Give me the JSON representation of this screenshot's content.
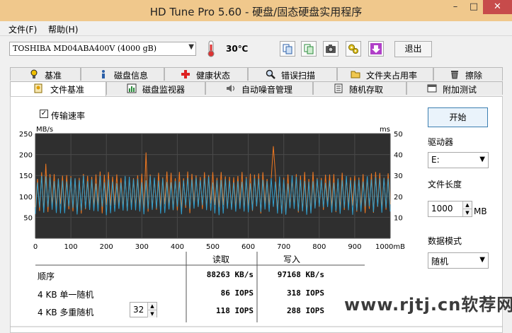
{
  "window": {
    "title": "HD Tune Pro 5.60 - 硬盘/固态硬盘实用程序",
    "min": "–",
    "max": "□",
    "close": "✕"
  },
  "menu": {
    "file": "文件(F)",
    "help": "帮助(H)"
  },
  "toolbar": {
    "drive": "TOSHIBA MD04ABA400V (4000 gB)",
    "temperature": "30℃",
    "exit": "退出"
  },
  "tabs_row1": [
    {
      "label": "基准",
      "icon": "benchmark-icon"
    },
    {
      "label": "磁盘信息",
      "icon": "disk-info-icon"
    },
    {
      "label": "健康状态",
      "icon": "health-icon"
    },
    {
      "label": "错误扫描",
      "icon": "error-scan-icon"
    },
    {
      "label": "文件夹占用率",
      "icon": "folder-icon"
    },
    {
      "label": "擦除",
      "icon": "erase-icon"
    }
  ],
  "tabs_row2": [
    {
      "label": "文件基准",
      "icon": "file-benchmark-icon",
      "active": true
    },
    {
      "label": "磁盘监视器",
      "icon": "disk-monitor-icon"
    },
    {
      "label": "自动噪音管理",
      "icon": "speaker-icon"
    },
    {
      "label": "随机存取",
      "icon": "random-access-icon"
    },
    {
      "label": "附加测试",
      "icon": "extra-tests-icon"
    }
  ],
  "options": {
    "transfer_rate_label": "传输速率",
    "transfer_rate_checked": true
  },
  "side": {
    "start": "开始",
    "drive_label": "驱动器",
    "drive_value": "E:",
    "file_length_label": "文件长度",
    "file_length_value": "1000",
    "file_length_unit": "MB",
    "data_mode_label": "数据模式",
    "data_mode_value": "随机"
  },
  "results": {
    "read_header": "读取",
    "write_header": "写入",
    "rows": [
      {
        "label": "顺序",
        "read": "88263 KB/s",
        "write": "97168 KB/s"
      },
      {
        "label": "4 KB 单一随机",
        "read": "86 IOPS",
        "write": "318 IOPS"
      },
      {
        "label": "4 KB 多重随机",
        "read": "118 IOPS",
        "write": "288 IOPS"
      }
    ],
    "queue_depth": "32"
  },
  "watermark": "www.rjtj.cn软荐网",
  "chart_data": {
    "type": "line",
    "left_unit": "MB/s",
    "right_unit": "ms",
    "x_unit": "mB",
    "xlim": [
      0,
      1000
    ],
    "ylim_left": [
      0,
      250
    ],
    "ylim_right": [
      0,
      50
    ],
    "x_ticks": [
      "0",
      "100",
      "200",
      "300",
      "400",
      "500",
      "600",
      "700",
      "800",
      "900",
      "1000mB"
    ],
    "y_ticks_left": [
      "250",
      "200",
      "150",
      "100",
      "50"
    ],
    "y_ticks_right": [
      "50",
      "40",
      "30",
      "20",
      "10"
    ],
    "grid": true,
    "series": [
      {
        "color": "#f07820",
        "axis": "left",
        "low": 58,
        "high": 160,
        "spikes": [
          [
            30,
            178
          ],
          [
            310,
            205
          ],
          [
            670,
            220
          ]
        ]
      },
      {
        "color": "#30a0d0",
        "axis": "left",
        "low": 55,
        "high": 150,
        "spikes": []
      }
    ]
  }
}
